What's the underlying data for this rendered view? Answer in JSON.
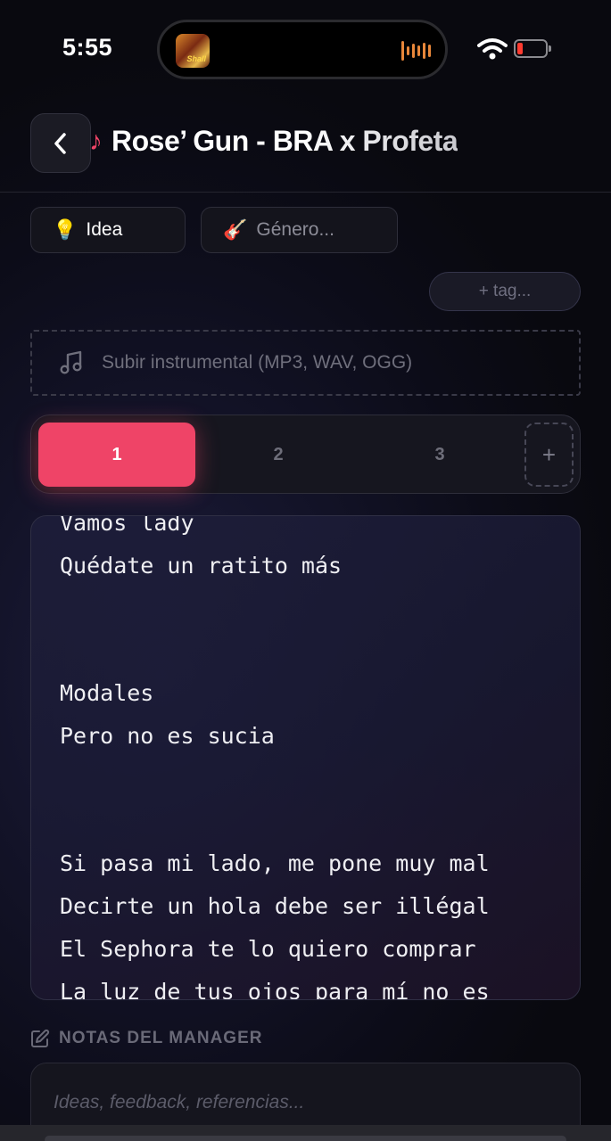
{
  "status_bar": {
    "time": "5:55",
    "album_art_text": "Shall"
  },
  "header": {
    "note_icon": "♪",
    "title": "Rose’ Gun - BRA x Profeta"
  },
  "chips": {
    "idea": {
      "emoji": "💡",
      "label": "Idea"
    },
    "genre": {
      "emoji": "🎸",
      "placeholder": "Género..."
    }
  },
  "tag_button": "+ tag...",
  "upload": {
    "label": "Subir instrumental (MP3, WAV, OGG)"
  },
  "versions": {
    "tabs": [
      "1",
      "2",
      "3"
    ],
    "active": "1",
    "add_label": "+"
  },
  "lyrics": {
    "lines": [
      "Vamos lady",
      "Quédate un ratito más",
      "",
      "",
      "Modales",
      "Pero no es sucia",
      "",
      "",
      "Si pasa mi lado, me pone muy mal",
      "Decirte un hola debe ser illégal",
      "El Sephora te lo quiero comprar",
      "La luz de tus ojos para mí no es"
    ]
  },
  "notes": {
    "label": "NOTAS DEL MANAGER",
    "placeholder": "Ideas, feedback, referencias..."
  },
  "colors": {
    "accent": "#ef4467",
    "background": "#0c0c18",
    "island_waveform": "#e8873a"
  }
}
